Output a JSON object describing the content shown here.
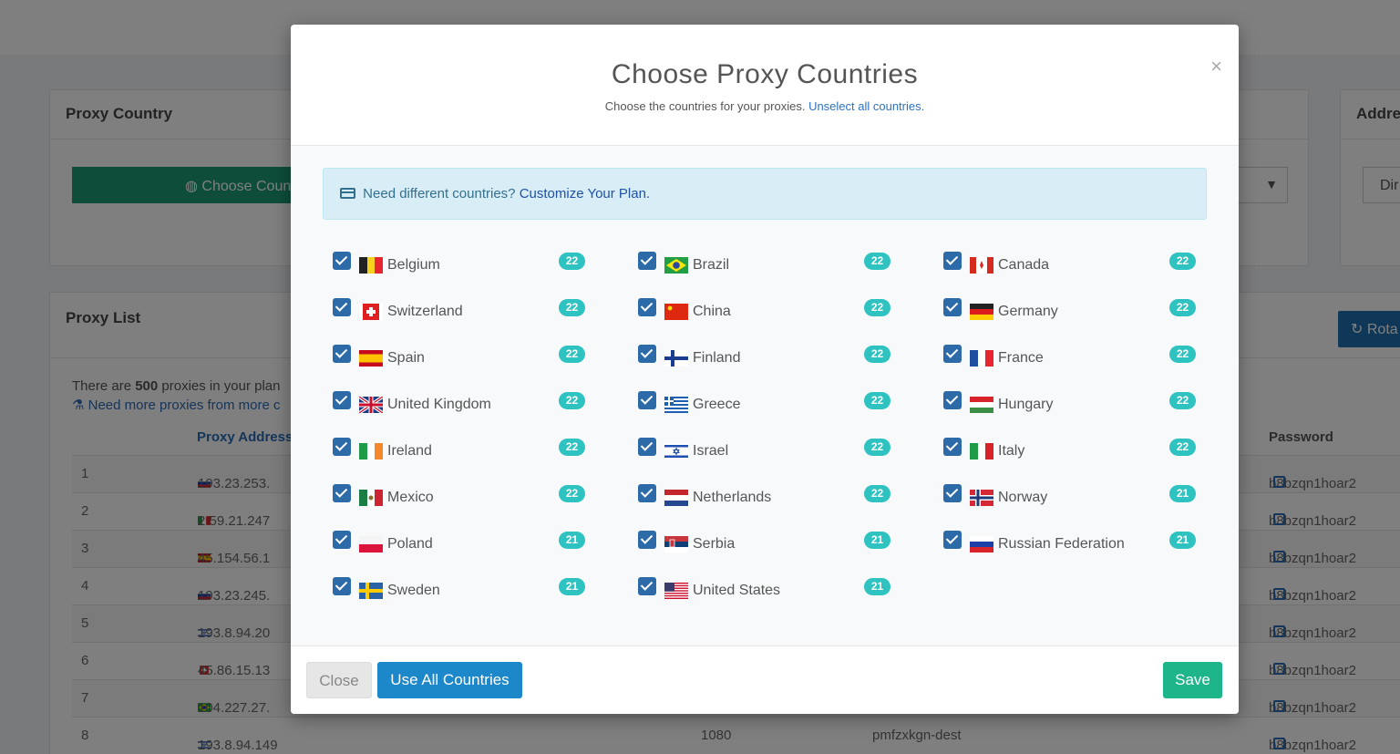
{
  "background": {
    "country_panel": {
      "title": "Proxy Country",
      "choose_label": "Choose Coun",
      "select_arrow": "▼"
    },
    "address_panel": {
      "title": "Addre",
      "dir_label": "Dir"
    },
    "list_panel": {
      "title": "Proxy List",
      "rotate_label": "Rota",
      "info_pre": "There are ",
      "info_count": "500",
      "info_post": " proxies in your plan",
      "need_more": "Need more proxies from more c",
      "col_address": "Proxy Address",
      "col_password": "Password",
      "rows": [
        {
          "n": "1",
          "addr": "193.23.253.",
          "flag": "ru",
          "pass": "b8bzqn1hoar2"
        },
        {
          "n": "2",
          "addr": "2.59.21.247",
          "flag": "it",
          "pass": "b8bzqn1hoar2"
        },
        {
          "n": "3",
          "addr": "45.154.56.1",
          "flag": "es",
          "pass": "b8bzqn1hoar2"
        },
        {
          "n": "4",
          "addr": "193.23.245.",
          "flag": "ru",
          "pass": "b8bzqn1hoar2"
        },
        {
          "n": "5",
          "addr": "193.8.94.20",
          "flag": "il",
          "pass": "b8bzqn1hoar2"
        },
        {
          "n": "6",
          "addr": "45.86.15.13",
          "flag": "ch",
          "pass": "b8bzqn1hoar2"
        },
        {
          "n": "7",
          "addr": "104.227.27.",
          "flag": "br",
          "pass": "b8bzqn1hoar2"
        },
        {
          "n": "8",
          "addr": "193.8.94.149",
          "flag": "il",
          "pass": "b8bzqn1hoar2",
          "port": "1080",
          "user": "pmfzxkgn-dest"
        }
      ]
    }
  },
  "modal": {
    "title": "Choose Proxy Countries",
    "subtitle": "Choose the countries for your proxies.",
    "unselect_link": "Unselect all countries.",
    "close_x": "×",
    "alert_text": "Need different countries?",
    "alert_link": "Customize Your Plan.",
    "countries": [
      {
        "name": "Belgium",
        "count": "22",
        "flag": "be"
      },
      {
        "name": "Brazil",
        "count": "22",
        "flag": "br"
      },
      {
        "name": "Canada",
        "count": "22",
        "flag": "ca"
      },
      {
        "name": "Switzerland",
        "count": "22",
        "flag": "ch"
      },
      {
        "name": "China",
        "count": "22",
        "flag": "cn"
      },
      {
        "name": "Germany",
        "count": "22",
        "flag": "de"
      },
      {
        "name": "Spain",
        "count": "22",
        "flag": "es"
      },
      {
        "name": "Finland",
        "count": "22",
        "flag": "fi"
      },
      {
        "name": "France",
        "count": "22",
        "flag": "fr"
      },
      {
        "name": "United Kingdom",
        "count": "22",
        "flag": "gb"
      },
      {
        "name": "Greece",
        "count": "22",
        "flag": "gr"
      },
      {
        "name": "Hungary",
        "count": "22",
        "flag": "hu"
      },
      {
        "name": "Ireland",
        "count": "22",
        "flag": "ie"
      },
      {
        "name": "Israel",
        "count": "22",
        "flag": "il"
      },
      {
        "name": "Italy",
        "count": "22",
        "flag": "it"
      },
      {
        "name": "Mexico",
        "count": "22",
        "flag": "mx"
      },
      {
        "name": "Netherlands",
        "count": "22",
        "flag": "nl"
      },
      {
        "name": "Norway",
        "count": "21",
        "flag": "no"
      },
      {
        "name": "Poland",
        "count": "21",
        "flag": "pl"
      },
      {
        "name": "Serbia",
        "count": "21",
        "flag": "rs"
      },
      {
        "name": "Russian Federation",
        "count": "21",
        "flag": "ru"
      },
      {
        "name": "Sweden",
        "count": "21",
        "flag": "se"
      },
      {
        "name": "United States",
        "count": "21",
        "flag": "us"
      }
    ],
    "footer": {
      "close_label": "Close",
      "use_all_label": "Use All Countries",
      "save_label": "Save"
    }
  }
}
